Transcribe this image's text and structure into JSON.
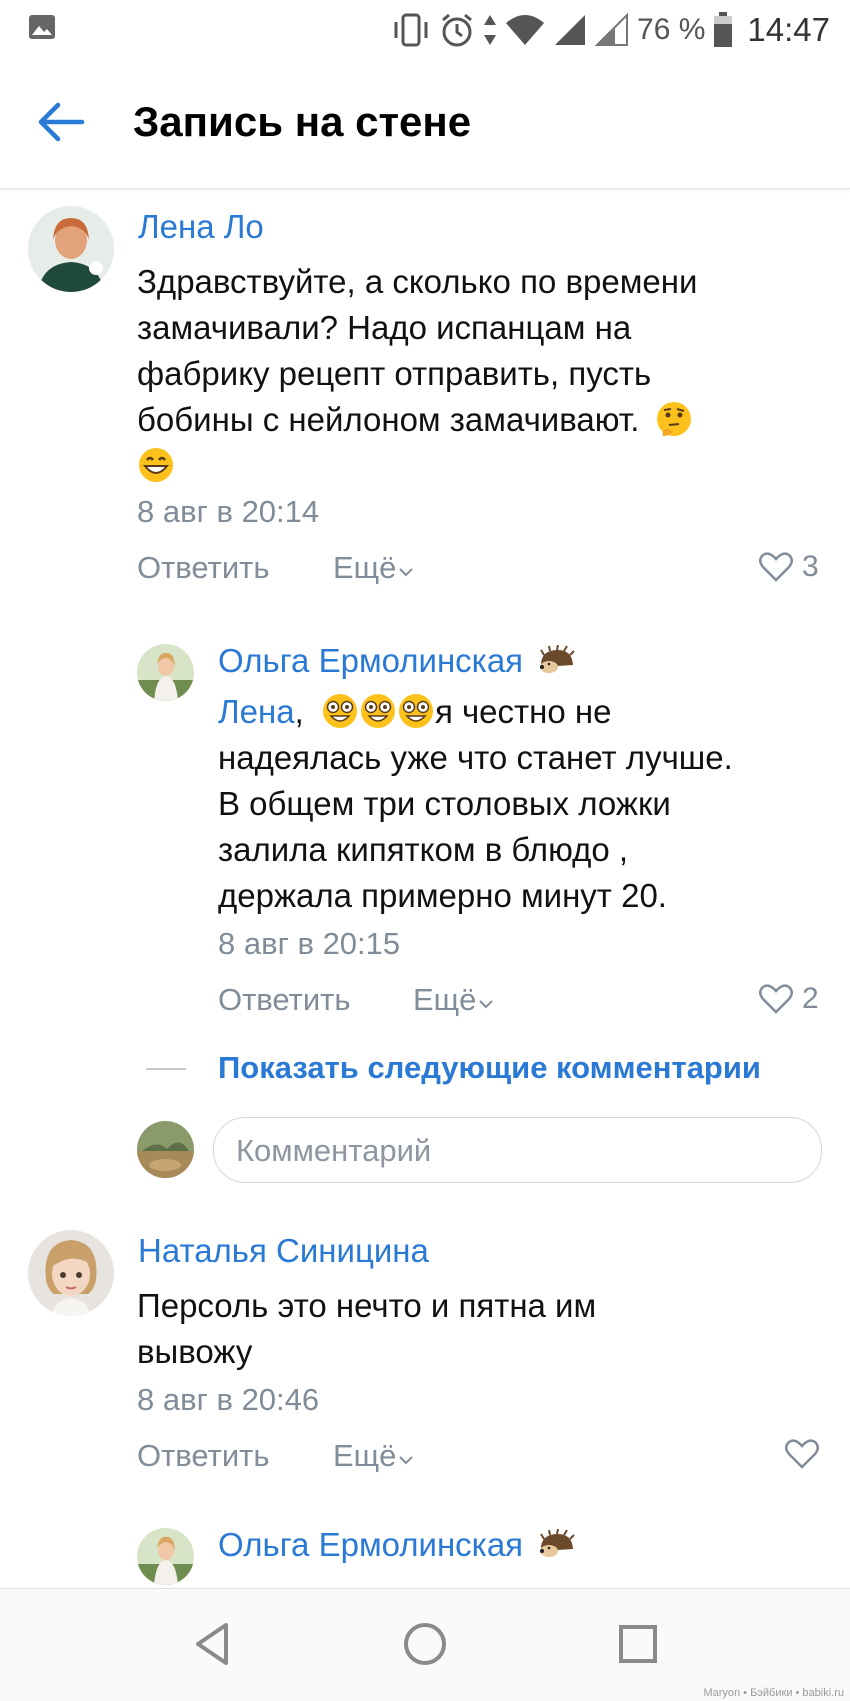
{
  "status_bar": {
    "battery": "76 %",
    "time": "14:47",
    "icons": [
      "image-icon",
      "vibrate-icon",
      "alarm-icon",
      "data-arrows-icon",
      "wifi-icon",
      "signal-icon",
      "signal-icon-2",
      "battery-icon"
    ]
  },
  "header": {
    "title": "Запись на стене",
    "back_icon": "arrow-left-icon"
  },
  "comments": [
    {
      "author": "Лена Ло",
      "text_lines": [
        "Здравствуйте, а сколько по времени",
        "замачивали? Надо испанцам на",
        "фабрику рецепт отправить, пусть",
        "бобины с нейлоном замачивают."
      ],
      "emojis": [
        "thinking-emoji",
        "grin-emoji"
      ],
      "date": "8 авг в 20:14",
      "reply_label": "Ответить",
      "more_label": "Ещё",
      "likes": "3"
    },
    {
      "author": "Ольга Ермолинская",
      "author_badge": "hedgehog-emoji",
      "mention": "Лена",
      "text_after_mention": ",",
      "text_first_line": "я честно не",
      "text_lines": [
        "надеялась уже что станет лучше.",
        "В общем три столовых ложки",
        "залила кипятком в блюдо ,",
        "держала примерно минут 20."
      ],
      "emojis": [
        "astonished-emoji",
        "astonished-emoji",
        "astonished-emoji"
      ],
      "date": "8 авг в 20:15",
      "reply_label": "Ответить",
      "more_label": "Ещё",
      "likes": "2"
    },
    {
      "author": "Наталья Синицина",
      "text_lines": [
        "Персоль это нечто и пятна им",
        "вывожу"
      ],
      "date": "8 авг в 20:46",
      "reply_label": "Ответить",
      "more_label": "Ещё",
      "likes": ""
    },
    {
      "author": "Ольга Ермолинская",
      "author_badge": "hedgehog-emoji"
    }
  ],
  "show_more": "Показать следующие комментарии",
  "comment_input": {
    "placeholder": "Комментарий"
  },
  "navbar": {
    "icons": [
      "back-triangle-icon",
      "home-circle-icon",
      "recents-square-icon"
    ]
  },
  "watermark": "Maryon • Бэйбики • babiki.ru",
  "colors": {
    "link": "#2a7ad5",
    "meta": "#818c99"
  }
}
